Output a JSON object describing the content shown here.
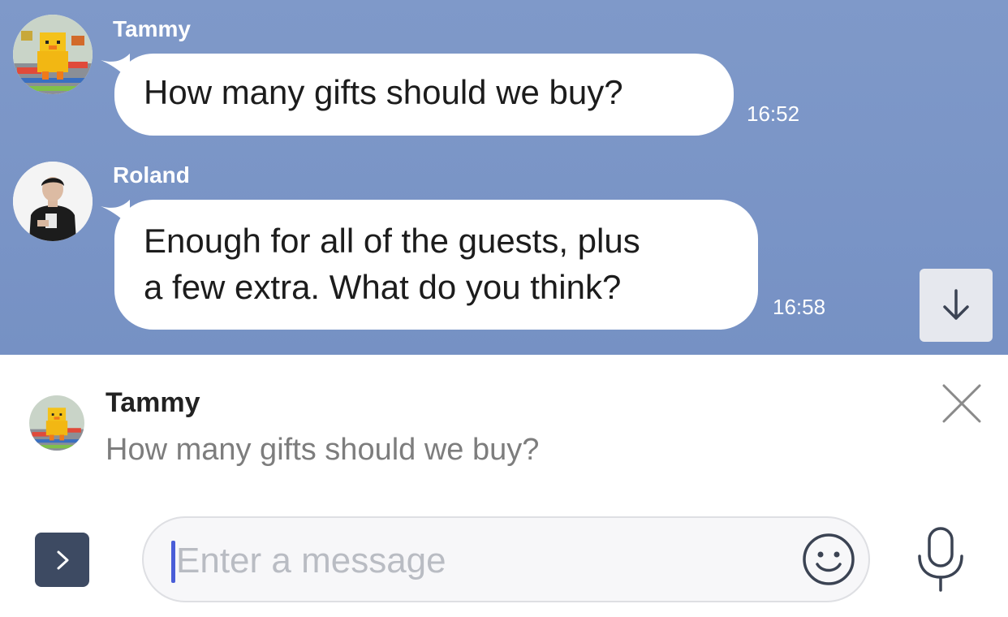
{
  "messages": [
    {
      "sender": "Tammy",
      "text": "How many gifts should we buy?",
      "time": "16:52",
      "avatar_icon": "yellow-duck-avatar"
    },
    {
      "sender": "Roland",
      "text_lines": [
        "Enough for all of the guests, plus",
        "a few extra. What do you think?"
      ],
      "time": "16:58",
      "avatar_icon": "man-in-black-tshirt-avatar"
    }
  ],
  "reply": {
    "sender": "Tammy",
    "text": "How many gifts should we buy?",
    "avatar_icon": "yellow-duck-avatar"
  },
  "input": {
    "placeholder": "Enter a message"
  },
  "icons": {
    "scroll_down": "arrow-down-icon",
    "close": "close-icon",
    "expand": "chevron-right-icon",
    "emoji": "smiley-icon",
    "mic": "microphone-icon"
  },
  "colors": {
    "chat_background": "#7d97c8",
    "bubble": "#ffffff",
    "expand_button": "#3d4a62",
    "caret": "#4a5ed8"
  }
}
